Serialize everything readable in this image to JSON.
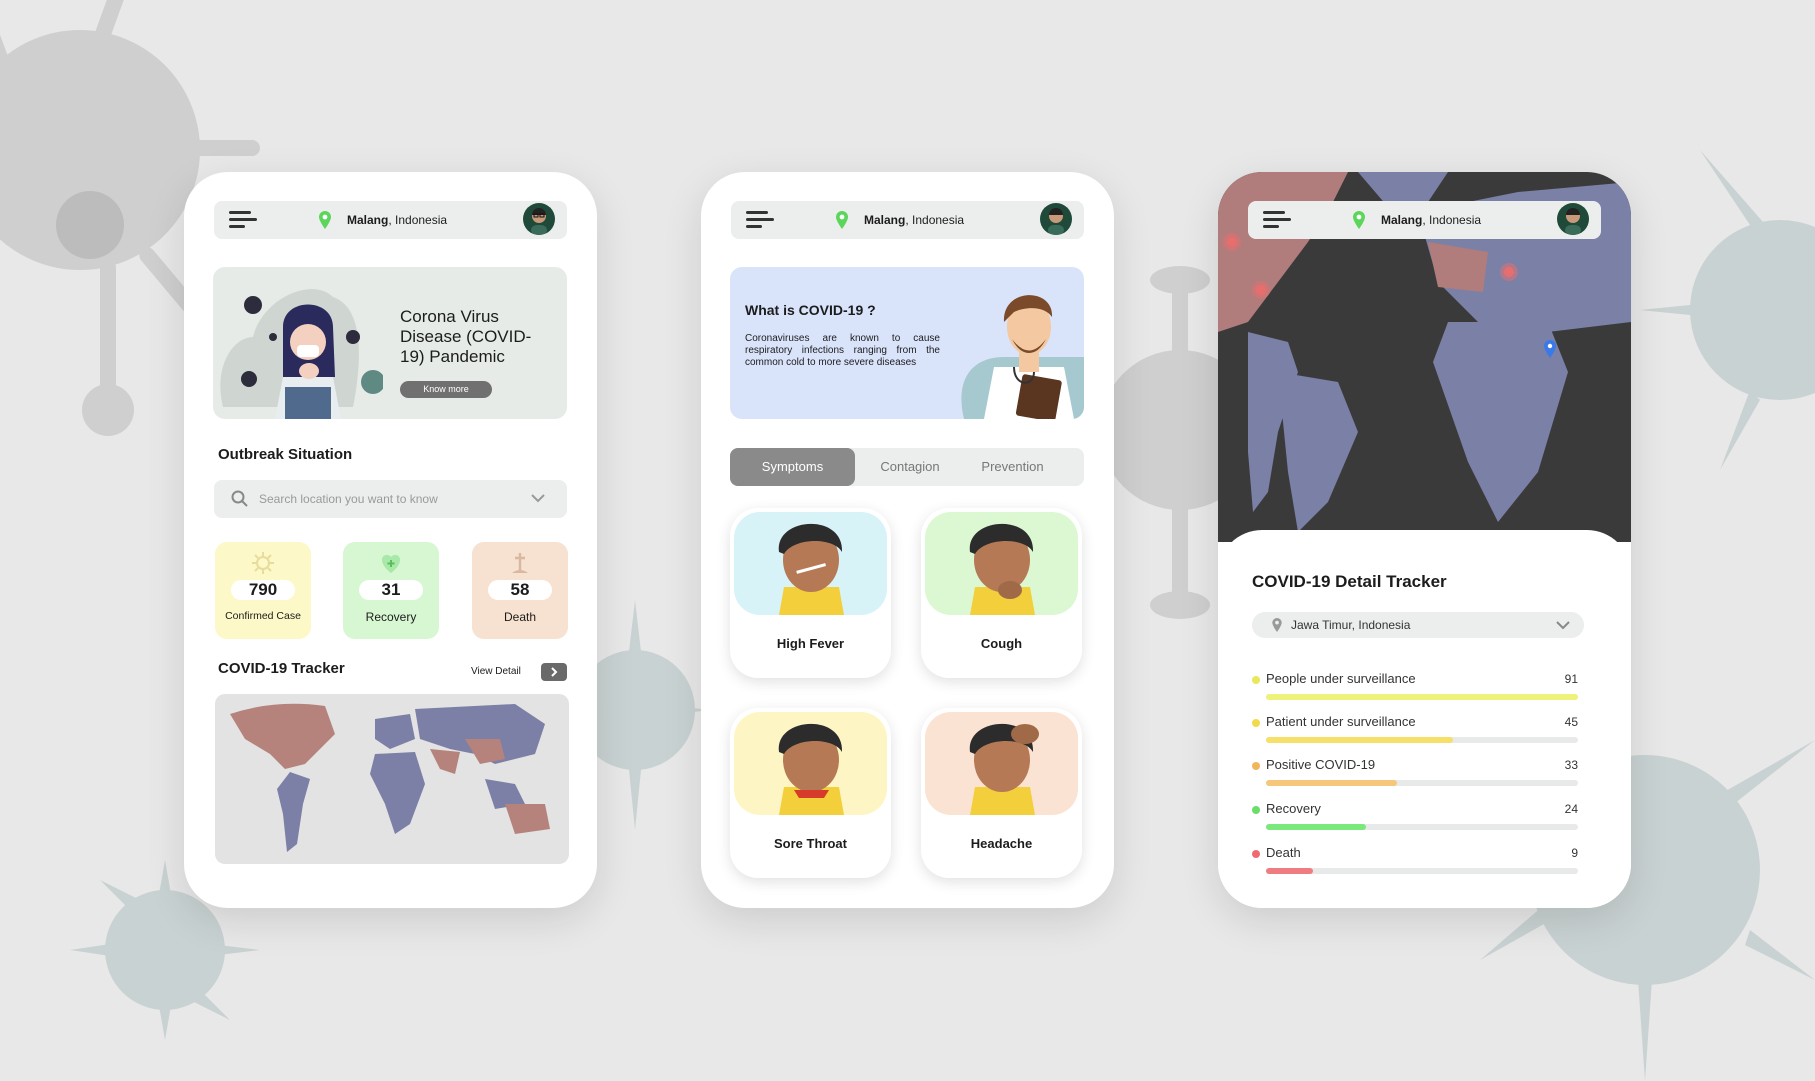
{
  "location": {
    "city": "Malang",
    "country": ", Indonesia"
  },
  "phone1": {
    "hero": {
      "title": "Corona Virus Disease (COVID-19) Pandemic",
      "button": "Know more"
    },
    "outbreak_title": "Outbreak Situation",
    "search_placeholder": "Search location you want to know",
    "stats": [
      {
        "value": "790",
        "label": "Confirmed Case",
        "color": "#fdf8c8"
      },
      {
        "value": "31",
        "label": "Recovery",
        "color": "#d7f7d2"
      },
      {
        "value": "58",
        "label": "Death",
        "color": "#f7e1d0"
      }
    ],
    "tracker_title": "COVID-19 Tracker",
    "view_detail": "View Detail"
  },
  "phone2": {
    "info": {
      "title": "What is COVID-19 ?",
      "body": "Coronaviruses are known to cause respiratory infections ranging from the common cold to more severe diseases"
    },
    "tabs": [
      "Symptoms",
      "Contagion",
      "Prevention"
    ],
    "symptoms": [
      {
        "label": "High Fever",
        "icon": "fever-icon",
        "color": "#d8f3f8"
      },
      {
        "label": "Cough",
        "icon": "cough-icon",
        "color": "#dcf8d2"
      },
      {
        "label": "Sore Throat",
        "icon": "sore-throat-icon",
        "color": "#fdf6c4"
      },
      {
        "label": "Headache",
        "icon": "headache-icon",
        "color": "#fbe3d4"
      }
    ]
  },
  "phone3": {
    "title": "COVID-19 Detail Tracker",
    "region": "Jawa Timur, Indonesia",
    "rows": [
      {
        "label": "People under surveillance",
        "value": "91",
        "fraction": 1.0,
        "color": "#eef27a",
        "dot": "#e8e85a"
      },
      {
        "label": "Patient under surveillance",
        "value": "45",
        "fraction": 0.6,
        "color": "#f6e06a",
        "dot": "#f3d94c"
      },
      {
        "label": "Positive COVID-19",
        "value": "33",
        "fraction": 0.42,
        "color": "#f6c77a",
        "dot": "#f2b65a"
      },
      {
        "label": "Recovery",
        "value": "24",
        "fraction": 0.32,
        "color": "#7ae87a",
        "dot": "#6add6a"
      },
      {
        "label": "Death",
        "value": "9",
        "fraction": 0.15,
        "color": "#ef7c80",
        "dot": "#ee6a70"
      }
    ]
  }
}
